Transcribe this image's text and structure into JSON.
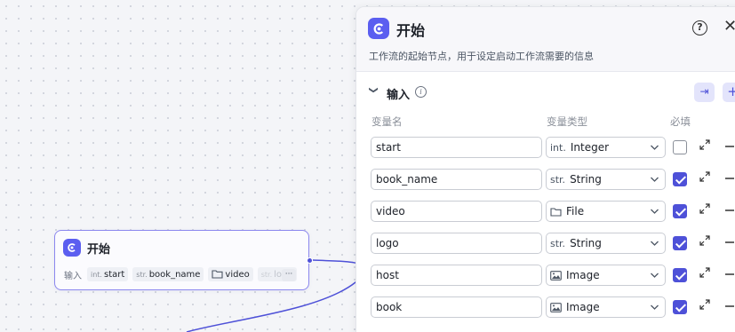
{
  "node": {
    "title": "开始",
    "inputs_label": "输入",
    "chips": [
      {
        "type": "int.",
        "name": "start"
      },
      {
        "type": "str.",
        "name": "book_name"
      },
      {
        "type": "folder-icon",
        "name": "video"
      },
      {
        "type": "str.",
        "name": "logo"
      }
    ],
    "more": "···"
  },
  "panel": {
    "title": "开始",
    "description": "工作流的起始节点，用于设定启动工作流需要的信息",
    "help": "?",
    "close": "✕",
    "section": {
      "title": "输入",
      "info": "i",
      "chevron": "❯",
      "import": "⇥",
      "add": "+"
    },
    "columns": {
      "name": "变量名",
      "type": "变量类型",
      "required": "必填"
    },
    "rows": [
      {
        "name": "start",
        "type_prefix": "int.",
        "type_icon": "",
        "type": "Integer",
        "required": false
      },
      {
        "name": "book_name",
        "type_prefix": "str.",
        "type_icon": "",
        "type": "String",
        "required": true
      },
      {
        "name": "video",
        "type_prefix": "",
        "type_icon": "folder-icon",
        "type": "File",
        "required": true
      },
      {
        "name": "logo",
        "type_prefix": "str.",
        "type_icon": "",
        "type": "String",
        "required": true
      },
      {
        "name": "host",
        "type_prefix": "",
        "type_icon": "image-icon",
        "type": "Image",
        "required": true
      },
      {
        "name": "book",
        "type_prefix": "",
        "type_icon": "image-icon",
        "type": "Image",
        "required": true
      }
    ]
  },
  "colors": {
    "accent": "#4e51d8",
    "node_border": "#8b87ee",
    "icon_bg": "#5b5ef0"
  }
}
